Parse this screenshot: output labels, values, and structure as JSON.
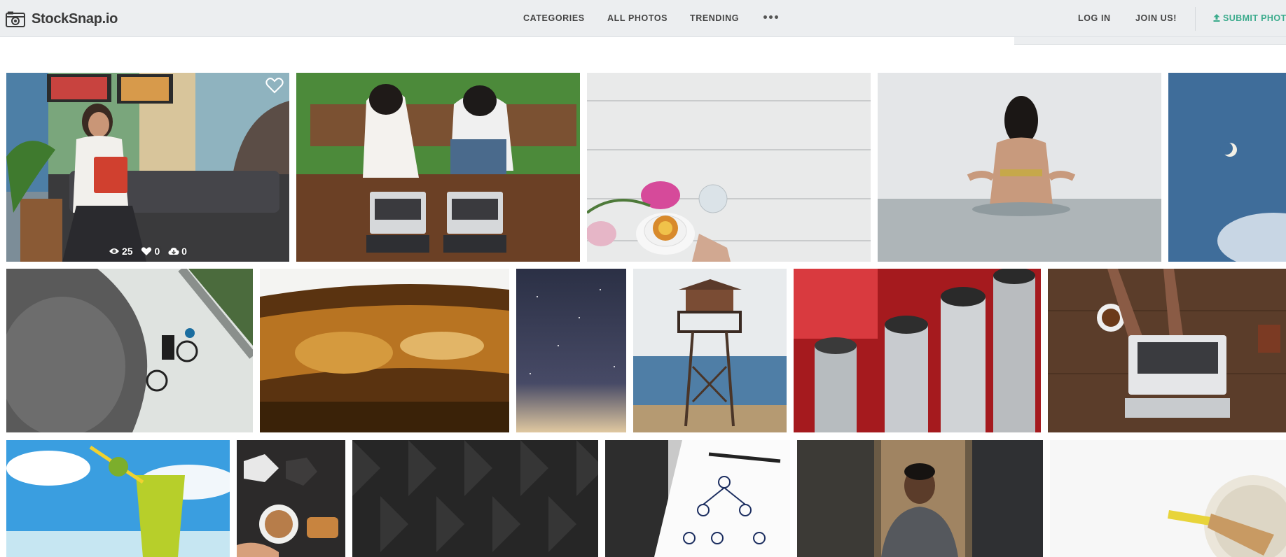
{
  "header": {
    "brand": "StockSnap.io",
    "logo_icon": "camera-icon",
    "nav": {
      "categories": "CATEGORIES",
      "all_photos": "ALL PHOTOS",
      "trending": "TRENDING",
      "more_icon": "more-dots-icon"
    },
    "login": "LOG IN",
    "join": "JOIN US!",
    "submit": "SUBMIT PHOT",
    "submit_icon": "upload-icon",
    "accent_color": "#3bab8c"
  },
  "gallery": {
    "hovered_photo": {
      "favorite_icon": "heart-outline-icon",
      "views": "25",
      "likes": "0",
      "downloads": "0",
      "views_icon": "eye-icon",
      "likes_icon": "heart-icon",
      "downloads_icon": "cloud-download-icon"
    },
    "photos": [
      "woman reading red book on sofa",
      "two people working on laptops at wooden table",
      "cup of tea with flowers on white wood",
      "woman wading in sea",
      "moon in blue sky",
      "cyclist on tiled path",
      "whiskey glass close-up",
      "starry night sky",
      "lifeguard tower on beach",
      "red metal tubes close-up",
      "hands typing on laptop on wooden desk",
      "green smoothie on beach",
      "hand holding latte",
      "dark geometric texture",
      "planning notepad sketch",
      "man in suit in office corridor",
      "wooden spatula on white plate"
    ]
  }
}
